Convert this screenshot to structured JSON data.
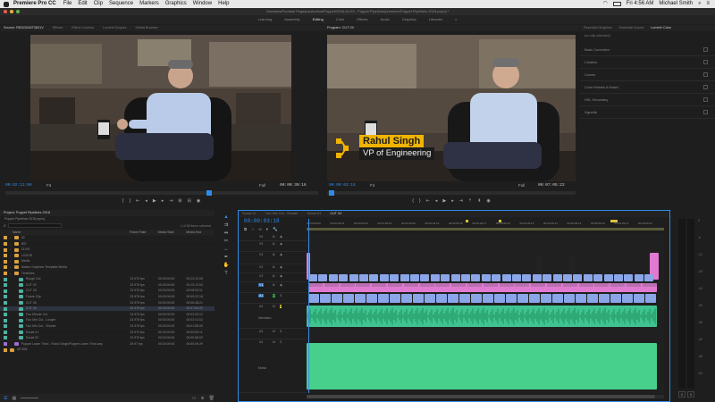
{
  "menubar": {
    "app_name": "Premiere Pro CC",
    "items": [
      "File",
      "Edit",
      "Clip",
      "Sequence",
      "Markers",
      "Graphics",
      "Window",
      "Help"
    ],
    "clock": "Fri 4:56 AM",
    "user": "Michael Smith"
  },
  "titlebar": {
    "path": "/Volumes/Promise Pegasus/Archive/Puppet/2018-04-03 - Puppet Pipelines/premiere/Puppet Pipelines 2018.prproj *"
  },
  "workspaces": [
    "Learning",
    "Assembly",
    "Editing",
    "Color",
    "Effects",
    "Audio",
    "Graphics",
    "Libraries"
  ],
  "workspace_active": "Editing",
  "source": {
    "tabs": [
      "Source: REDGIANT3601V",
      "Effects",
      "Effect Controls",
      "Lumetri Scopes",
      "Media Browser"
    ],
    "timecode_in": "00:02:11:06",
    "fit": "Fit",
    "full": "Full",
    "timecode_out": "00:00:30:16"
  },
  "program": {
    "tab": "Program: CUT 04",
    "lower_third_name": "Rahul Singh",
    "lower_third_title": "VP of Engineering",
    "timecode_in": "00:00:03:18",
    "fit": "Fit",
    "full": "Full",
    "timecode_out": "00:07:05:22"
  },
  "lumetri": {
    "tabs": [
      "Essential Graphics",
      "Essential Sound",
      "Lumetri Color"
    ],
    "clip_label": "(no clip selected)",
    "sections": [
      "Basic Correction",
      "Creative",
      "Curves",
      "Color Wheels & Match",
      "HSL Secondary",
      "Vignette"
    ]
  },
  "project": {
    "tab": "Project: Puppet Pipelines 2018",
    "file": "Puppet Pipelines 2018.prproj",
    "selected_info": "1 of 56 items selected",
    "columns": [
      "Name",
      "Frame Rate",
      "Media Start",
      "Media End"
    ],
    "rows": [
      {
        "name": "02",
        "fr": "",
        "ms": "",
        "me": "",
        "indent": 1,
        "type": "folder",
        "sw": "#d8a040",
        "sel": false
      },
      {
        "name": "B/D",
        "fr": "",
        "ms": "",
        "me": "",
        "indent": 1,
        "type": "folder",
        "sw": "#d8a040",
        "sel": false
      },
      {
        "name": "CLNS",
        "fr": "",
        "ms": "",
        "me": "",
        "indent": 1,
        "type": "folder",
        "sw": "#d8a040",
        "sel": false
      },
      {
        "name": "LOGOS",
        "fr": "",
        "ms": "",
        "me": "",
        "indent": 1,
        "type": "folder",
        "sw": "#d8a040",
        "sel": false
      },
      {
        "name": "Media",
        "fr": "",
        "ms": "",
        "me": "",
        "indent": 1,
        "type": "folder",
        "sw": "#d8a040",
        "sel": false
      },
      {
        "name": "Motion Graphics Template Media",
        "fr": "",
        "ms": "",
        "me": "",
        "indent": 1,
        "type": "folder",
        "sw": "#d8a040",
        "sel": false
      },
      {
        "name": "Timelines",
        "fr": "",
        "ms": "",
        "me": "",
        "indent": 1,
        "type": "folder",
        "sw": "#d8a040",
        "sel": false
      },
      {
        "name": "Rough Cut",
        "fr": "23.976 fps",
        "ms": "00:00:00:00",
        "me": "00:14:12:05",
        "indent": 2,
        "type": "seq",
        "sw": "#4fb0a0",
        "sel": false
      },
      {
        "name": "CUT 02",
        "fr": "23.976 fps",
        "ms": "00:00:00:00",
        "me": "00:10:12:04",
        "indent": 2,
        "type": "seq",
        "sw": "#4fb0a0",
        "sel": false
      },
      {
        "name": "CUT 03",
        "fr": "23.976 fps",
        "ms": "00:00:00:00",
        "me": "00:08:02:11",
        "indent": 2,
        "type": "seq",
        "sw": "#4fb0a0",
        "sel": false
      },
      {
        "name": "Future Clip",
        "fr": "23.976 fps",
        "ms": "00:00:00:00",
        "me": "00:00:22:18",
        "indent": 2,
        "type": "seq",
        "sw": "#4fb0a0",
        "sel": false
      },
      {
        "name": "CUT 05",
        "fr": "23.976 fps",
        "ms": "00:00:00:00",
        "me": "00:06:48:21",
        "indent": 2,
        "type": "seq",
        "sw": "#4fb0a0",
        "sel": false
      },
      {
        "name": "CUT 04",
        "fr": "23.976 fps",
        "ms": "00:00:00:00",
        "me": "00:07:05:22",
        "indent": 2,
        "type": "seq",
        "sw": "#4fb0a0",
        "sel": true
      },
      {
        "name": "Two Minute Cut",
        "fr": "23.976 fps",
        "ms": "00:00:00:00",
        "me": "00:02:03:12",
        "indent": 2,
        "type": "seq",
        "sw": "#4fb0a0",
        "sel": false
      },
      {
        "name": "Two Min Cut - Longer",
        "fr": "23.976 fps",
        "ms": "00:00:00:00",
        "me": "00:02:41:02",
        "indent": 2,
        "type": "seq",
        "sw": "#4fb0a0",
        "sel": false
      },
      {
        "name": "Two Min Cut - Shorter",
        "fr": "23.976 fps",
        "ms": "00:00:00:00",
        "me": "00:01:55:09",
        "indent": 2,
        "type": "seq",
        "sw": "#4fb0a0",
        "sel": false
      },
      {
        "name": "Social 01",
        "fr": "23.976 fps",
        "ms": "00:00:00:00",
        "me": "00:00:59:11",
        "indent": 2,
        "type": "seq",
        "sw": "#4fb0a0",
        "sel": false
      },
      {
        "name": "Social 02",
        "fr": "23.976 fps",
        "ms": "00:00:00:00",
        "me": "00:00:58:02",
        "indent": 2,
        "type": "seq",
        "sw": "#4fb0a0",
        "sel": false
      },
      {
        "name": "Puppet Lower Third - Rahul Singh/Puppet Lower Third.aep",
        "fr": "29.97 fps",
        "ms": "00:00:00:00",
        "me": "00:00:09:29",
        "indent": 1,
        "type": "ae",
        "sw": "#9b6fd0",
        "sel": false
      },
      {
        "name": "AE BIN",
        "fr": "",
        "ms": "",
        "me": "",
        "indent": 0,
        "type": "folder",
        "sw": "#d8a040",
        "sel": false
      }
    ]
  },
  "timeline": {
    "tabs": [
      "Social 02",
      "Two Min Cut - Shorter",
      "Social 01",
      "CUT 04"
    ],
    "active_tab": "CUT 04",
    "timecode": "00:00:03:18",
    "ruler_labels": [
      "00:00:00:00",
      "00:00:29:23",
      "00:00:59:22",
      "00:01:29:21",
      "00:01:59:20",
      "00:02:29:19",
      "00:02:59:18",
      "00:03:29:17",
      "00:03:59:16",
      "00:04:29:15",
      "00:04:59:14",
      "00:05:29:13",
      "00:05:59:12",
      "00:06:29:11",
      "00:06:59:10"
    ],
    "tracks": [
      "V6",
      "V5",
      "V4",
      "V3",
      "V2",
      "V1",
      "A1",
      "A2",
      "A3",
      "A4"
    ],
    "track_names": {
      "A2": "Narration",
      "A4": "Music"
    },
    "colors": {
      "video_pink": "#e07ad0",
      "video_blue": "#8aa6e8",
      "audio_green": "#3fc490",
      "music_green": "#46d08c",
      "playhead": "#3a8ee8"
    }
  },
  "meters": {
    "db_labels": [
      "0",
      "-6",
      "-12",
      "-18",
      "-24",
      "-30",
      "-36",
      "-42",
      "-48",
      "-54"
    ],
    "solo": "S"
  }
}
